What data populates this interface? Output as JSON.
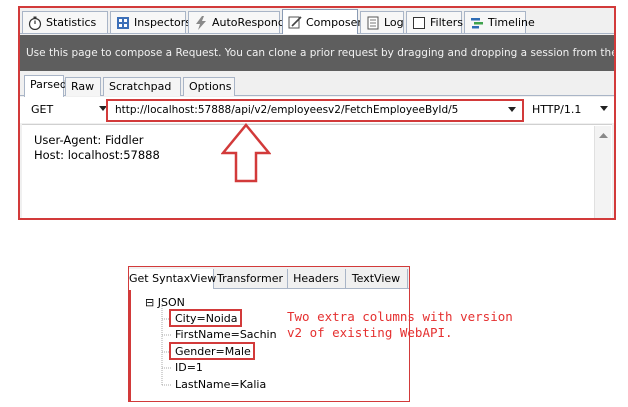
{
  "main_tabs": [
    {
      "label": "Statistics",
      "icon": "stopwatch-icon"
    },
    {
      "label": "Inspectors",
      "icon": "inspectors-icon"
    },
    {
      "label": "AutoResponder",
      "icon": "lightning-icon"
    },
    {
      "label": "Composer",
      "icon": "compose-icon",
      "active": true
    },
    {
      "label": "Log",
      "icon": "log-icon"
    },
    {
      "label": "Filters",
      "icon": "checkbox-icon"
    },
    {
      "label": "Timeline",
      "icon": "timeline-icon"
    }
  ],
  "info_text": "Use this page to compose a Request. You can clone a prior request by dragging and dropping a session from the Web Sessions li",
  "sub_tabs": [
    "Parsed",
    "Raw",
    "Scratchpad",
    "Options"
  ],
  "request": {
    "method": "GET",
    "url": "http://localhost:57888/api/v2/employeesv2/FetchEmployeeById/5",
    "http_version": "HTTP/1.1"
  },
  "headers": [
    "User-Agent: Fiddler",
    "Host: localhost:57888"
  ],
  "bottom_tabs": [
    "Get SyntaxView",
    "Transformer",
    "Headers",
    "TextView"
  ],
  "tree": {
    "root": "JSON",
    "root_toggle": "⊟",
    "children": [
      "City=Noida",
      "FirstName=Sachin",
      "Gender=Male",
      "ID=1",
      "LastName=Kalia"
    ]
  },
  "annotation": "Two extra columns with version\nv2 of existing WebAPI.",
  "colors": {
    "highlight": "#d23a3a",
    "annotation": "#e53030",
    "info_bar": "#5e5e5e"
  }
}
